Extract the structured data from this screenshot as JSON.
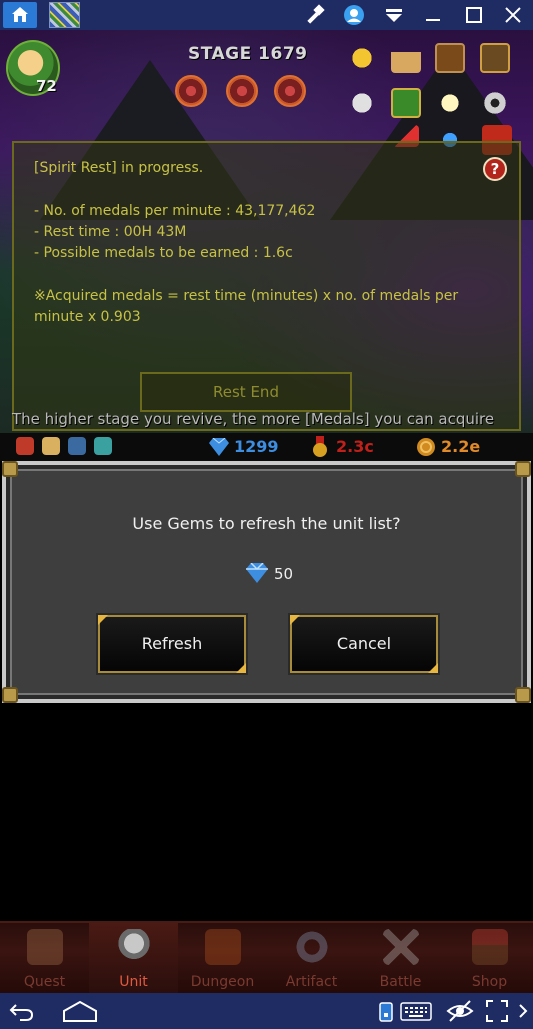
{
  "titlebar": {
    "icons": [
      "home-icon",
      "game-thumbnail-icon",
      "hammer-icon",
      "account-icon",
      "menu-down-icon",
      "minimize-icon",
      "maximize-icon",
      "close-icon"
    ]
  },
  "game": {
    "player_level": "72",
    "stage_title": "STAGE 1679",
    "right_icons": [
      "trophy-icon",
      "ranking-icon",
      "quest-book-icon",
      "notebook-icon",
      "chat-icon",
      "cross-icon",
      "angel-icon",
      "gear-icon",
      "warning-icon",
      "ghost-icon",
      "gift-icon"
    ]
  },
  "spirit_rest": {
    "status": "[Spirit Rest] in progress.",
    "medals_per_minute": "- No. of medals per minute : 43,177,462",
    "rest_time": "- Rest time : 00H 43M",
    "possible_medals": "- Possible medals to be earned : 1.6c",
    "formula_line1": "※Acquired medals = rest time (minutes) x no. of medals per",
    "formula_line2": "minute x 0.903",
    "rest_end_label": "Rest End",
    "help_label": "?"
  },
  "hint": "The higher stage you revive, the more [Medals] you can acquire",
  "resources": {
    "gems": "1299",
    "medals": "2.3c",
    "gold": "2.2e",
    "gem_color": "#3d8ee0",
    "medal_color": "#c0201a",
    "gold_color": "#e08a2a"
  },
  "dialog": {
    "message": "Use Gems to refresh the unit list?",
    "cost": "50",
    "refresh_label": "Refresh",
    "cancel_label": "Cancel"
  },
  "tabs": [
    {
      "label": "Quest",
      "icon": "scroll-icon",
      "active": false
    },
    {
      "label": "Unit",
      "icon": "helmet-icon",
      "active": true
    },
    {
      "label": "Dungeon",
      "icon": "monster-icon",
      "active": false
    },
    {
      "label": "Artifact",
      "icon": "ring-icon",
      "active": false
    },
    {
      "label": "Battle",
      "icon": "crossed-swords-icon",
      "active": false
    },
    {
      "label": "Shop",
      "icon": "shop-icon",
      "active": false
    }
  ],
  "navbar": {
    "icons": [
      "back-icon",
      "home-icon",
      "phone-icon",
      "keyboard-icon",
      "eye-icon",
      "fullscreen-icon",
      "chevron-right-icon"
    ]
  }
}
